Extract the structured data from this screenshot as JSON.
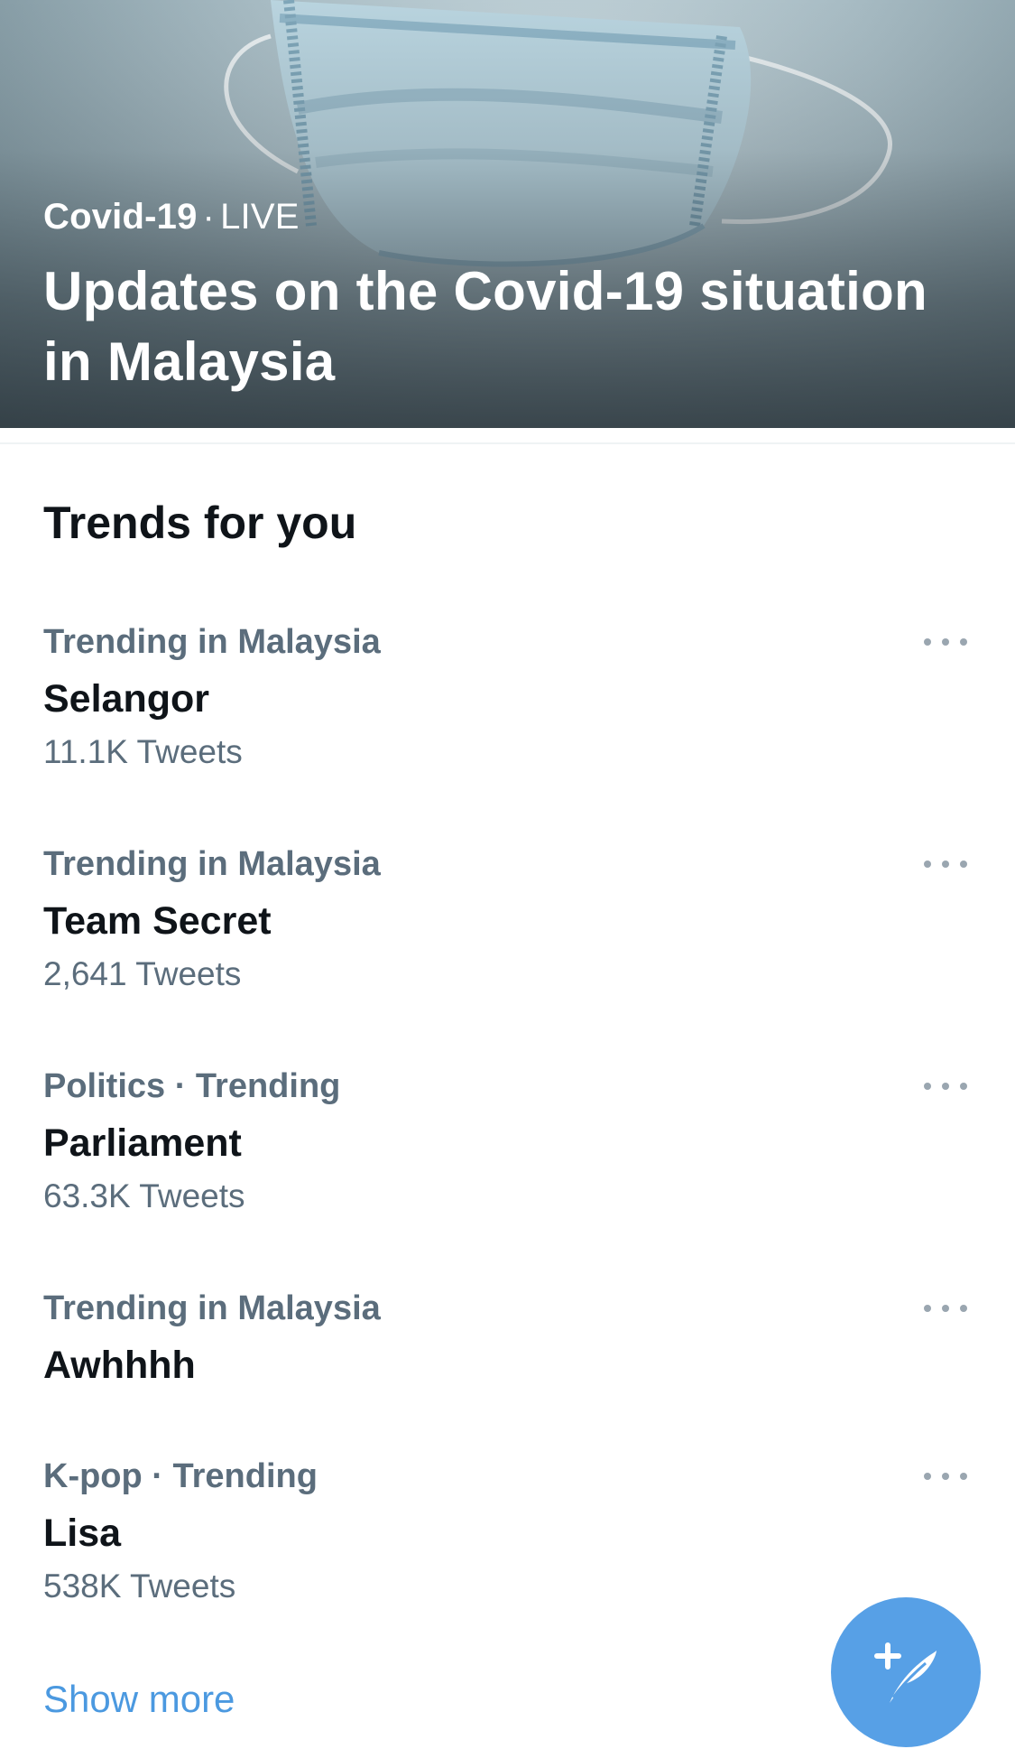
{
  "hero": {
    "topic": "Covid-19",
    "separator": "·",
    "status": "LIVE",
    "title": "Updates on the Covid-19 situation in Malaysia",
    "image_icon": "face-mask-image"
  },
  "trends": {
    "section_title": "Trends for you",
    "items": [
      {
        "context": "Trending in Malaysia",
        "name": "Selangor",
        "count": "11.1K Tweets"
      },
      {
        "context": "Trending in Malaysia",
        "name": "Team Secret",
        "count": "2,641 Tweets"
      },
      {
        "context": "Politics · Trending",
        "name": "Parliament",
        "count": "63.3K Tweets"
      },
      {
        "context": "Trending in Malaysia",
        "name": "Awhhhh",
        "count": ""
      },
      {
        "context": "K-pop · Trending",
        "name": "Lisa",
        "count": "538K Tweets"
      }
    ],
    "more_icon": "more-horizontal-icon",
    "show_more_label": "Show more"
  },
  "fab": {
    "icon": "compose-tweet-icon"
  },
  "colors": {
    "accent": "#57a0e6",
    "link": "#4b99e0",
    "secondary_text": "#5b6d7c",
    "primary_text": "#0f1419",
    "divider": "#eff3f4"
  }
}
